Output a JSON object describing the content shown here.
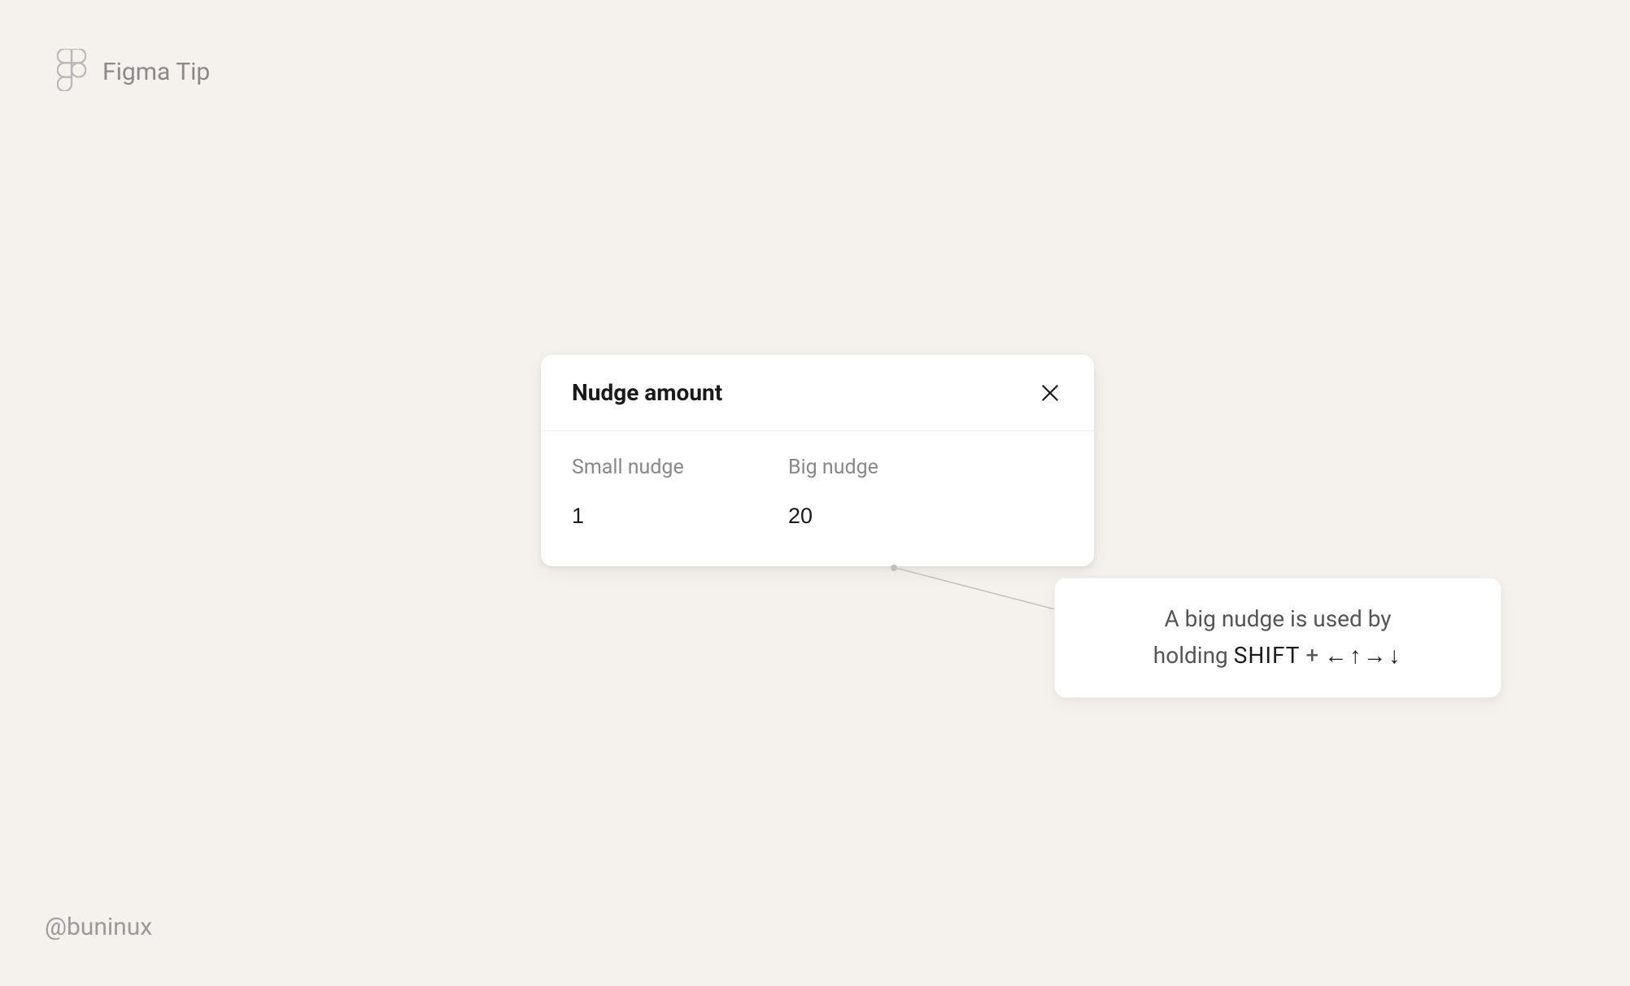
{
  "header": {
    "title": "Figma Tip"
  },
  "dialog": {
    "title": "Nudge amount",
    "small_nudge_label": "Small nudge",
    "small_nudge_value": "1",
    "big_nudge_label": "Big nudge",
    "big_nudge_value": "20"
  },
  "tooltip": {
    "line1": "A big nudge is used by",
    "line2_prefix": "holding ",
    "shift_key": "SHIFT",
    "plus": " + ",
    "arrows": "←↑→↓"
  },
  "footer": {
    "handle": "@buninux"
  }
}
